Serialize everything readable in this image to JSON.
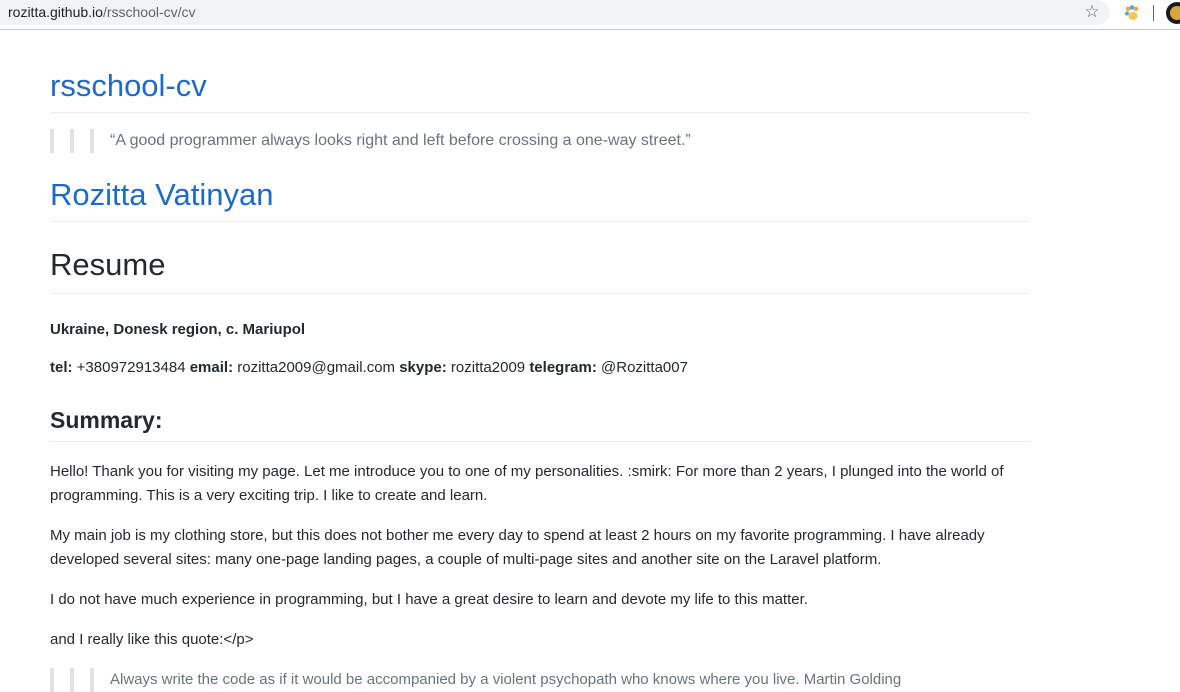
{
  "browser": {
    "url_host": "rozitta.github.io",
    "url_path": "/rsschool-cv/cv",
    "star_icon": "star-icon",
    "extension_icon": "paw-extension-icon",
    "avatar_icon": "profile-avatar"
  },
  "page": {
    "site_title": "rsschool-cv",
    "quote": "“A good programmer always looks right and left before crossing a one-way street.”",
    "name": "Rozitta Vatinyan",
    "resume_heading": "Resume",
    "location": "Ukraine, Donesk region, c. Mariupol",
    "contacts": {
      "tel_label": "tel:",
      "tel": "+380972913484",
      "email_label": "email:",
      "email": "rozitta2009@gmail.com",
      "skype_label": "skype:",
      "skype": "rozitta2009",
      "telegram_label": "telegram:",
      "telegram": "@Rozitta007"
    },
    "summary_heading": "Summary:",
    "paragraphs": [
      "Hello! Thank you for visiting my page. Let me introduce you to one of my personalities. :smirk: For more than 2 years, I plunged into the world of programming. This is a very exciting trip. I like to create and learn.",
      "My main job is my clothing store, but this does not bother me every day to spend at least 2 hours on my favorite programming. I have already developed several sites: many one-page landing pages, a couple of multi-page sites and another site on the Laravel platform.",
      "I do not have much experience in programming, but I have a great desire to learn and devote my life to this matter.",
      "and I really like this quote:</p>"
    ],
    "bottom_quote": "Always write the code as if it would be accompanied by a violent psychopath who knows where you live. Martin Golding"
  },
  "colors": {
    "link_blue": "#1d6bc6",
    "text": "#24292e",
    "muted": "#6a737d",
    "rule": "#eaecef"
  }
}
